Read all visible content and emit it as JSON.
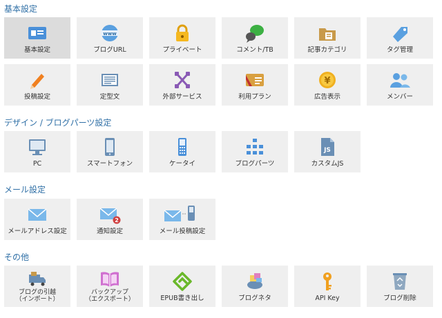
{
  "sections": {
    "basic": {
      "title": "基本設定"
    },
    "design": {
      "title": "デザイン / ブログパーツ設定"
    },
    "mail": {
      "title": "メール設定"
    },
    "other": {
      "title": "その他"
    }
  },
  "tiles": {
    "basic_settings": "基本設定",
    "blog_url": "ブログURL",
    "privacy": "プライベート",
    "comment_tb": "コメント/TB",
    "category": "記事カテゴリ",
    "tags": "タグ管理",
    "post_settings": "投稿設定",
    "template_text": "定型文",
    "external_services": "外部サービス",
    "plan": "利用プラン",
    "ads": "広告表示",
    "members": "メンバー",
    "pc": "PC",
    "smartphone": "スマートフォン",
    "keitai": "ケータイ",
    "blog_parts": "ブログパーツ",
    "custom_js": "カスタムJS",
    "mail_address": "メールアドレス設定",
    "notification": "通知設定",
    "mail_post": "メール投稿設定",
    "import_line1": "ブログの引越",
    "import_line2": "（インポート）",
    "backup_line1": "バックアップ",
    "backup_line2": "（エクスポート）",
    "epub": "EPUB書き出し",
    "blog_neta": "ブログネタ",
    "api_key": "API Key",
    "delete_blog": "ブログ削除"
  },
  "badges": {
    "notification_count": "2"
  },
  "icon_texts": {
    "custom_js": "JS"
  },
  "colors": {
    "section_title": "#2f6fa6",
    "tile_bg": "#efefef",
    "tile_active": "#dcdcdc",
    "icon_blue": "#4a90d9"
  }
}
